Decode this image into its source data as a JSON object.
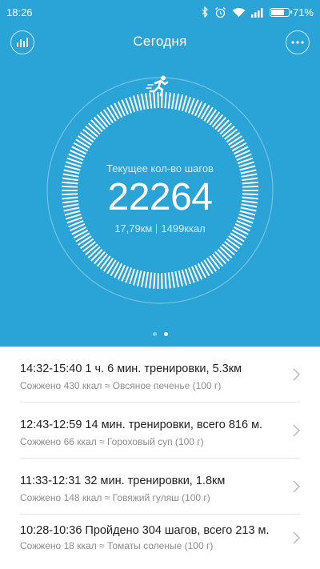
{
  "status_bar": {
    "time": "18:26",
    "battery": "71%",
    "icons": [
      "bluetooth-icon",
      "alarm-icon",
      "wifi-icon",
      "signal-icon",
      "battery-icon"
    ]
  },
  "header": {
    "title": "Сегодня",
    "left_icon": "bar-chart-icon",
    "right_icon": "more-icon"
  },
  "summary": {
    "label": "Текущее кол-во шагов",
    "steps": "22264",
    "distance": "17,79км",
    "calories": "1499ккал",
    "activity_icon": "running-icon"
  },
  "pager": {
    "active_index": 1,
    "count": 2
  },
  "activities": [
    {
      "title": "14:32-15:40  1 ч. 6 мин. тренировки, 5.3км",
      "detail": "Сожжено 430 ккал ≈ Овсяное печенье (100 г)"
    },
    {
      "title": "12:43-12:59  14 мин. тренировки,  всего 816 м.",
      "detail": "Сожжено 66 ккал ≈ Гороховый суп (100 г)"
    },
    {
      "title": "11:33-12:31  32 мин. тренировки, 1.8км",
      "detail": "Сожжено 148 ккал ≈ Говяжий гуляш (100 г)"
    },
    {
      "title": "10:28-10:36  Пройдено 304 шагов,  всего 213 м.",
      "detail": "Сожжено 18 ккал ≈ Томаты соленые (100 г)"
    }
  ],
  "colors": {
    "hero_background": "#2aa3d6",
    "divider": "#e4e4e4"
  }
}
